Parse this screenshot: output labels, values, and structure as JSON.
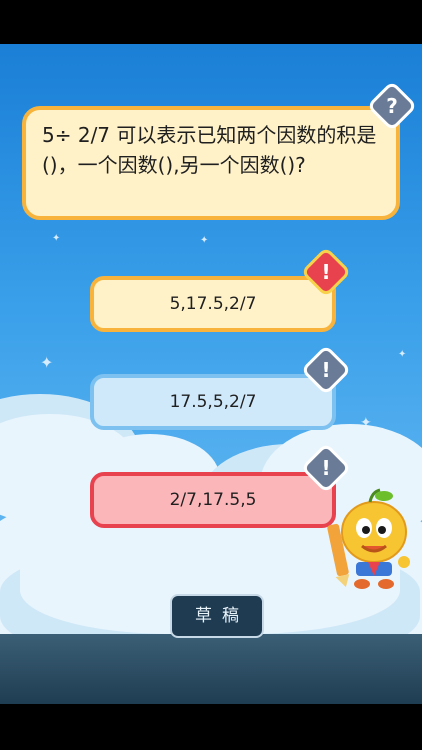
{
  "question": {
    "text": "5÷ 2/7 可以表示已知两个因数的积是()，一个因数(),另一个因数()?",
    "hint_icon": "question-mark-icon"
  },
  "answers": [
    {
      "label": "5,17.5,2/7",
      "state": "warning",
      "badge_glyph": "!"
    },
    {
      "label": "17.5,5,2/7",
      "state": "neutral",
      "badge_glyph": "!"
    },
    {
      "label": "2/7,17.5,5",
      "state": "selected",
      "badge_glyph": "!"
    }
  ],
  "toolbar": {
    "draft_label": "草稿"
  },
  "colors": {
    "sky_top": "#1a7fd6",
    "card_yellow_fill": "#fff2c9",
    "card_yellow_border": "#f7b33c",
    "card_blue_fill": "#cfe9fb",
    "card_blue_border": "#7cc1ef",
    "card_red_fill": "#fbb6b9",
    "card_red_border": "#e8424f",
    "bottom_bar": "#1e3b52"
  }
}
